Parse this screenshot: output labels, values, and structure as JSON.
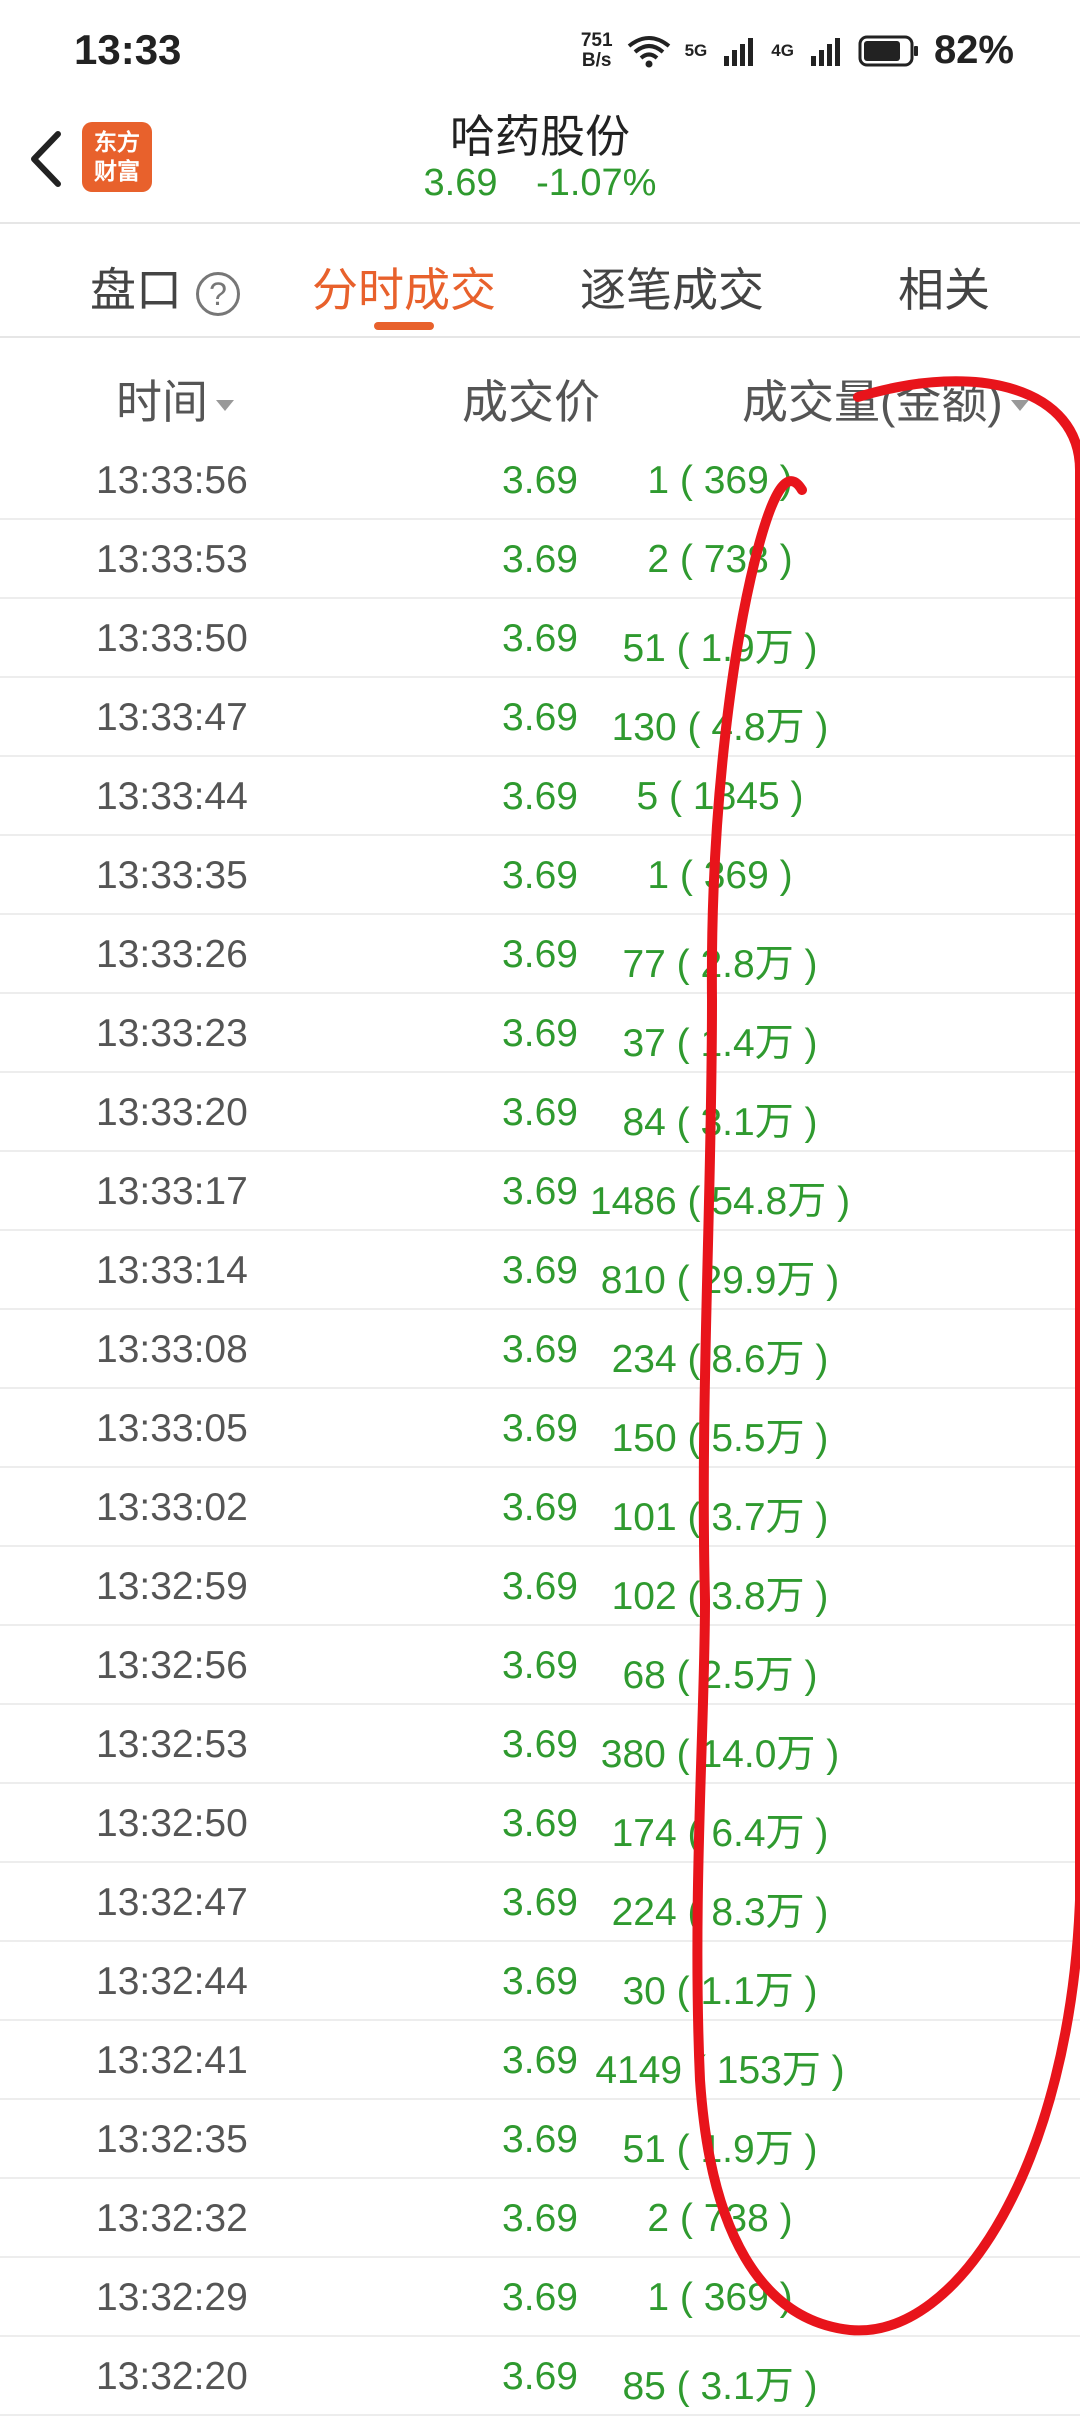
{
  "status_bar": {
    "time": "13:33",
    "net_speed_value": "751",
    "net_speed_unit": "B/s",
    "sig_5g": "5G",
    "sig_4g": "4G",
    "battery": "82%"
  },
  "header": {
    "logo_line1": "东方",
    "logo_line2": "财富",
    "stock_name": "哈药股份",
    "price": "3.69",
    "change": "-1.07%"
  },
  "tabs": {
    "pankou": "盘口",
    "help": "?",
    "fenshi": "分时成交",
    "zhubi": "逐笔成交",
    "xiangguan": "相关"
  },
  "table": {
    "headers": {
      "time": "时间",
      "price": "成交价",
      "volume": "成交量(金额)"
    },
    "rows": [
      {
        "time": "13:33:56",
        "price": "3.69",
        "volume": "1 ( 369 )"
      },
      {
        "time": "13:33:53",
        "price": "3.69",
        "volume": "2 ( 738 )"
      },
      {
        "time": "13:33:50",
        "price": "3.69",
        "volume": "51 ( 1.9万 )"
      },
      {
        "time": "13:33:47",
        "price": "3.69",
        "volume": "130 ( 4.8万 )"
      },
      {
        "time": "13:33:44",
        "price": "3.69",
        "volume": "5 ( 1845 )"
      },
      {
        "time": "13:33:35",
        "price": "3.69",
        "volume": "1 ( 369 )"
      },
      {
        "time": "13:33:26",
        "price": "3.69",
        "volume": "77 ( 2.8万 )"
      },
      {
        "time": "13:33:23",
        "price": "3.69",
        "volume": "37 ( 1.4万 )"
      },
      {
        "time": "13:33:20",
        "price": "3.69",
        "volume": "84 ( 3.1万 )"
      },
      {
        "time": "13:33:17",
        "price": "3.69",
        "volume": "1486 ( 54.8万 )"
      },
      {
        "time": "13:33:14",
        "price": "3.69",
        "volume": "810 ( 29.9万 )"
      },
      {
        "time": "13:33:08",
        "price": "3.69",
        "volume": "234 ( 8.6万 )"
      },
      {
        "time": "13:33:05",
        "price": "3.69",
        "volume": "150 ( 5.5万 )"
      },
      {
        "time": "13:33:02",
        "price": "3.69",
        "volume": "101 ( 3.7万 )"
      },
      {
        "time": "13:32:59",
        "price": "3.69",
        "volume": "102 ( 3.8万 )"
      },
      {
        "time": "13:32:56",
        "price": "3.69",
        "volume": "68 ( 2.5万 )"
      },
      {
        "time": "13:32:53",
        "price": "3.69",
        "volume": "380 ( 14.0万 )"
      },
      {
        "time": "13:32:50",
        "price": "3.69",
        "volume": "174 ( 6.4万 )"
      },
      {
        "time": "13:32:47",
        "price": "3.69",
        "volume": "224 ( 8.3万 )"
      },
      {
        "time": "13:32:44",
        "price": "3.69",
        "volume": "30 ( 1.1万 )"
      },
      {
        "time": "13:32:41",
        "price": "3.69",
        "volume": "4149 ( 153万 )"
      },
      {
        "time": "13:32:35",
        "price": "3.69",
        "volume": "51 ( 1.9万 )"
      },
      {
        "time": "13:32:32",
        "price": "3.69",
        "volume": "2 ( 738 )"
      },
      {
        "time": "13:32:29",
        "price": "3.69",
        "volume": "1 ( 369 )"
      },
      {
        "time": "13:32:20",
        "price": "3.69",
        "volume": "85 ( 3.1万 )"
      }
    ]
  },
  "colors": {
    "accent": "#e8612c",
    "up_down_green": "#2f9a2f",
    "annotation_red": "#e8141b"
  }
}
